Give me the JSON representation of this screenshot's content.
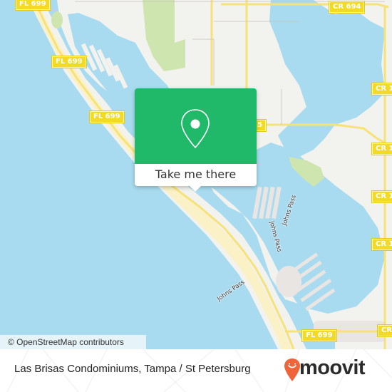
{
  "map": {
    "road_shields": [
      {
        "label": "FL 699"
      },
      {
        "label": "FL 699"
      },
      {
        "label": "FL 699"
      },
      {
        "label": "FL 699"
      },
      {
        "label": "CR 694"
      },
      {
        "label": "CR 1"
      },
      {
        "label": "CR 1"
      },
      {
        "label": "CR 1"
      },
      {
        "label": "CR 1"
      },
      {
        "label": "CR"
      },
      {
        "label": "5"
      }
    ],
    "water_labels": [
      {
        "label": "Johns Pass"
      },
      {
        "label": "Johns Pass"
      },
      {
        "label": "Johns Pass"
      }
    ],
    "colors": {
      "water": "#a8dbef",
      "land": "#f2f2ee",
      "park": "#cfe5b0",
      "beach": "#faf2c6",
      "road": "#f7e27a",
      "shield": "#f2da26"
    }
  },
  "popup": {
    "icon": "map-pin-icon",
    "button_label": "Take me there",
    "accent": "#1fb969"
  },
  "attribution": {
    "text": "© OpenStreetMap contributors"
  },
  "footer": {
    "title": "Las Brisas Condominiums, Tampa / St Petersburg",
    "brand": "moovit",
    "brand_color": "#f0643a"
  }
}
